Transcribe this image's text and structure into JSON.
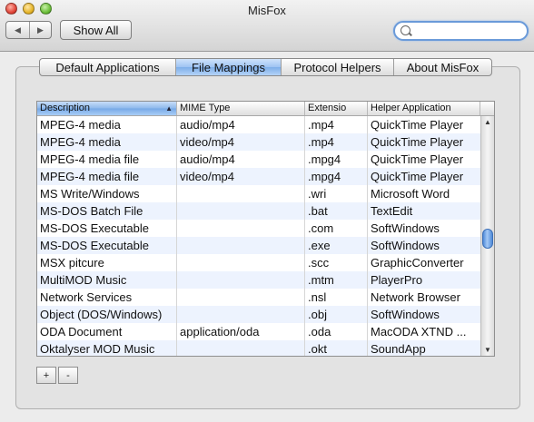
{
  "window": {
    "title": "MisFox"
  },
  "toolbar": {
    "back_glyph": "◀",
    "forward_glyph": "▶",
    "show_all_label": "Show All",
    "search": {
      "value": "",
      "placeholder": ""
    }
  },
  "tabs": [
    {
      "label": "Default Applications",
      "active": false
    },
    {
      "label": "File Mappings",
      "active": true
    },
    {
      "label": "Protocol Helpers",
      "active": false
    },
    {
      "label": "About MisFox",
      "active": false
    }
  ],
  "table": {
    "columns": [
      "Description",
      "MIME Type",
      "Extensio",
      "Helper Application"
    ],
    "sort_column": "Description",
    "sort_direction": "ascending",
    "rows": [
      [
        "MPEG-4 media",
        "audio/mp4",
        ".mp4",
        "QuickTime Player"
      ],
      [
        "MPEG-4 media",
        "video/mp4",
        ".mp4",
        "QuickTime Player"
      ],
      [
        "MPEG-4 media file",
        "audio/mp4",
        ".mpg4",
        "QuickTime Player"
      ],
      [
        "MPEG-4 media file",
        "video/mp4",
        ".mpg4",
        "QuickTime Player"
      ],
      [
        "MS Write/Windows",
        "",
        ".wri",
        "Microsoft Word"
      ],
      [
        "MS-DOS Batch File",
        "",
        ".bat",
        "TextEdit"
      ],
      [
        "MS-DOS Executable",
        "",
        ".com",
        "SoftWindows"
      ],
      [
        "MS-DOS Executable",
        "",
        ".exe",
        "SoftWindows"
      ],
      [
        "MSX pitcure",
        "",
        ".scc",
        "GraphicConverter"
      ],
      [
        "MultiMOD Music",
        "",
        ".mtm",
        "PlayerPro"
      ],
      [
        "Network Services",
        "",
        ".nsl",
        "Network Browser"
      ],
      [
        "Object (DOS/Windows)",
        "",
        ".obj",
        "SoftWindows"
      ],
      [
        "ODA Document",
        "application/oda",
        ".oda",
        "MacODA XTND ..."
      ],
      [
        "Oktalyser MOD Music",
        "",
        ".okt",
        "SoundApp"
      ]
    ]
  },
  "footer": {
    "add_label": "+",
    "remove_label": "-"
  },
  "colors": {
    "accent": "#6a9ad9",
    "selection_header": "#8db8ec",
    "row_alt": "#edf3fe"
  }
}
